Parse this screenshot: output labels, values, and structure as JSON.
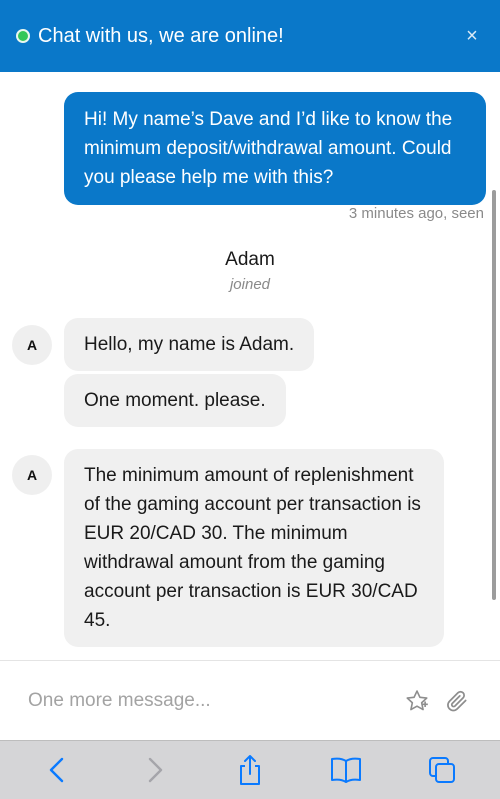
{
  "header": {
    "title": "Chat with us, we are online!",
    "close_glyph": "×",
    "status_color": "#34c759",
    "background": "#0a78c9"
  },
  "messages": {
    "user": {
      "text": "Hi! My name’s Dave and I’d like to know the minimum deposit/withdrawal amount. Could you please help me with this?",
      "meta": "3 minutes ago, seen"
    },
    "agent": {
      "name": "Adam",
      "status": "joined",
      "avatar_initial": "A"
    },
    "agent_messages": [
      "Hello, my name is Adam.",
      "One moment. please.",
      "The minimum amount of replenishment of the gaming account per transaction is EUR 20/CAD 30. The minimum withdrawal amount from the gaming account per transaction is EUR 30/CAD 45."
    ]
  },
  "composer": {
    "placeholder": "One more message...",
    "icons": [
      "star-icon",
      "paperclip-icon"
    ]
  },
  "toolbar": {
    "icons": [
      "back-icon",
      "forward-icon",
      "share-icon",
      "bookmarks-icon",
      "tabs-icon"
    ]
  }
}
